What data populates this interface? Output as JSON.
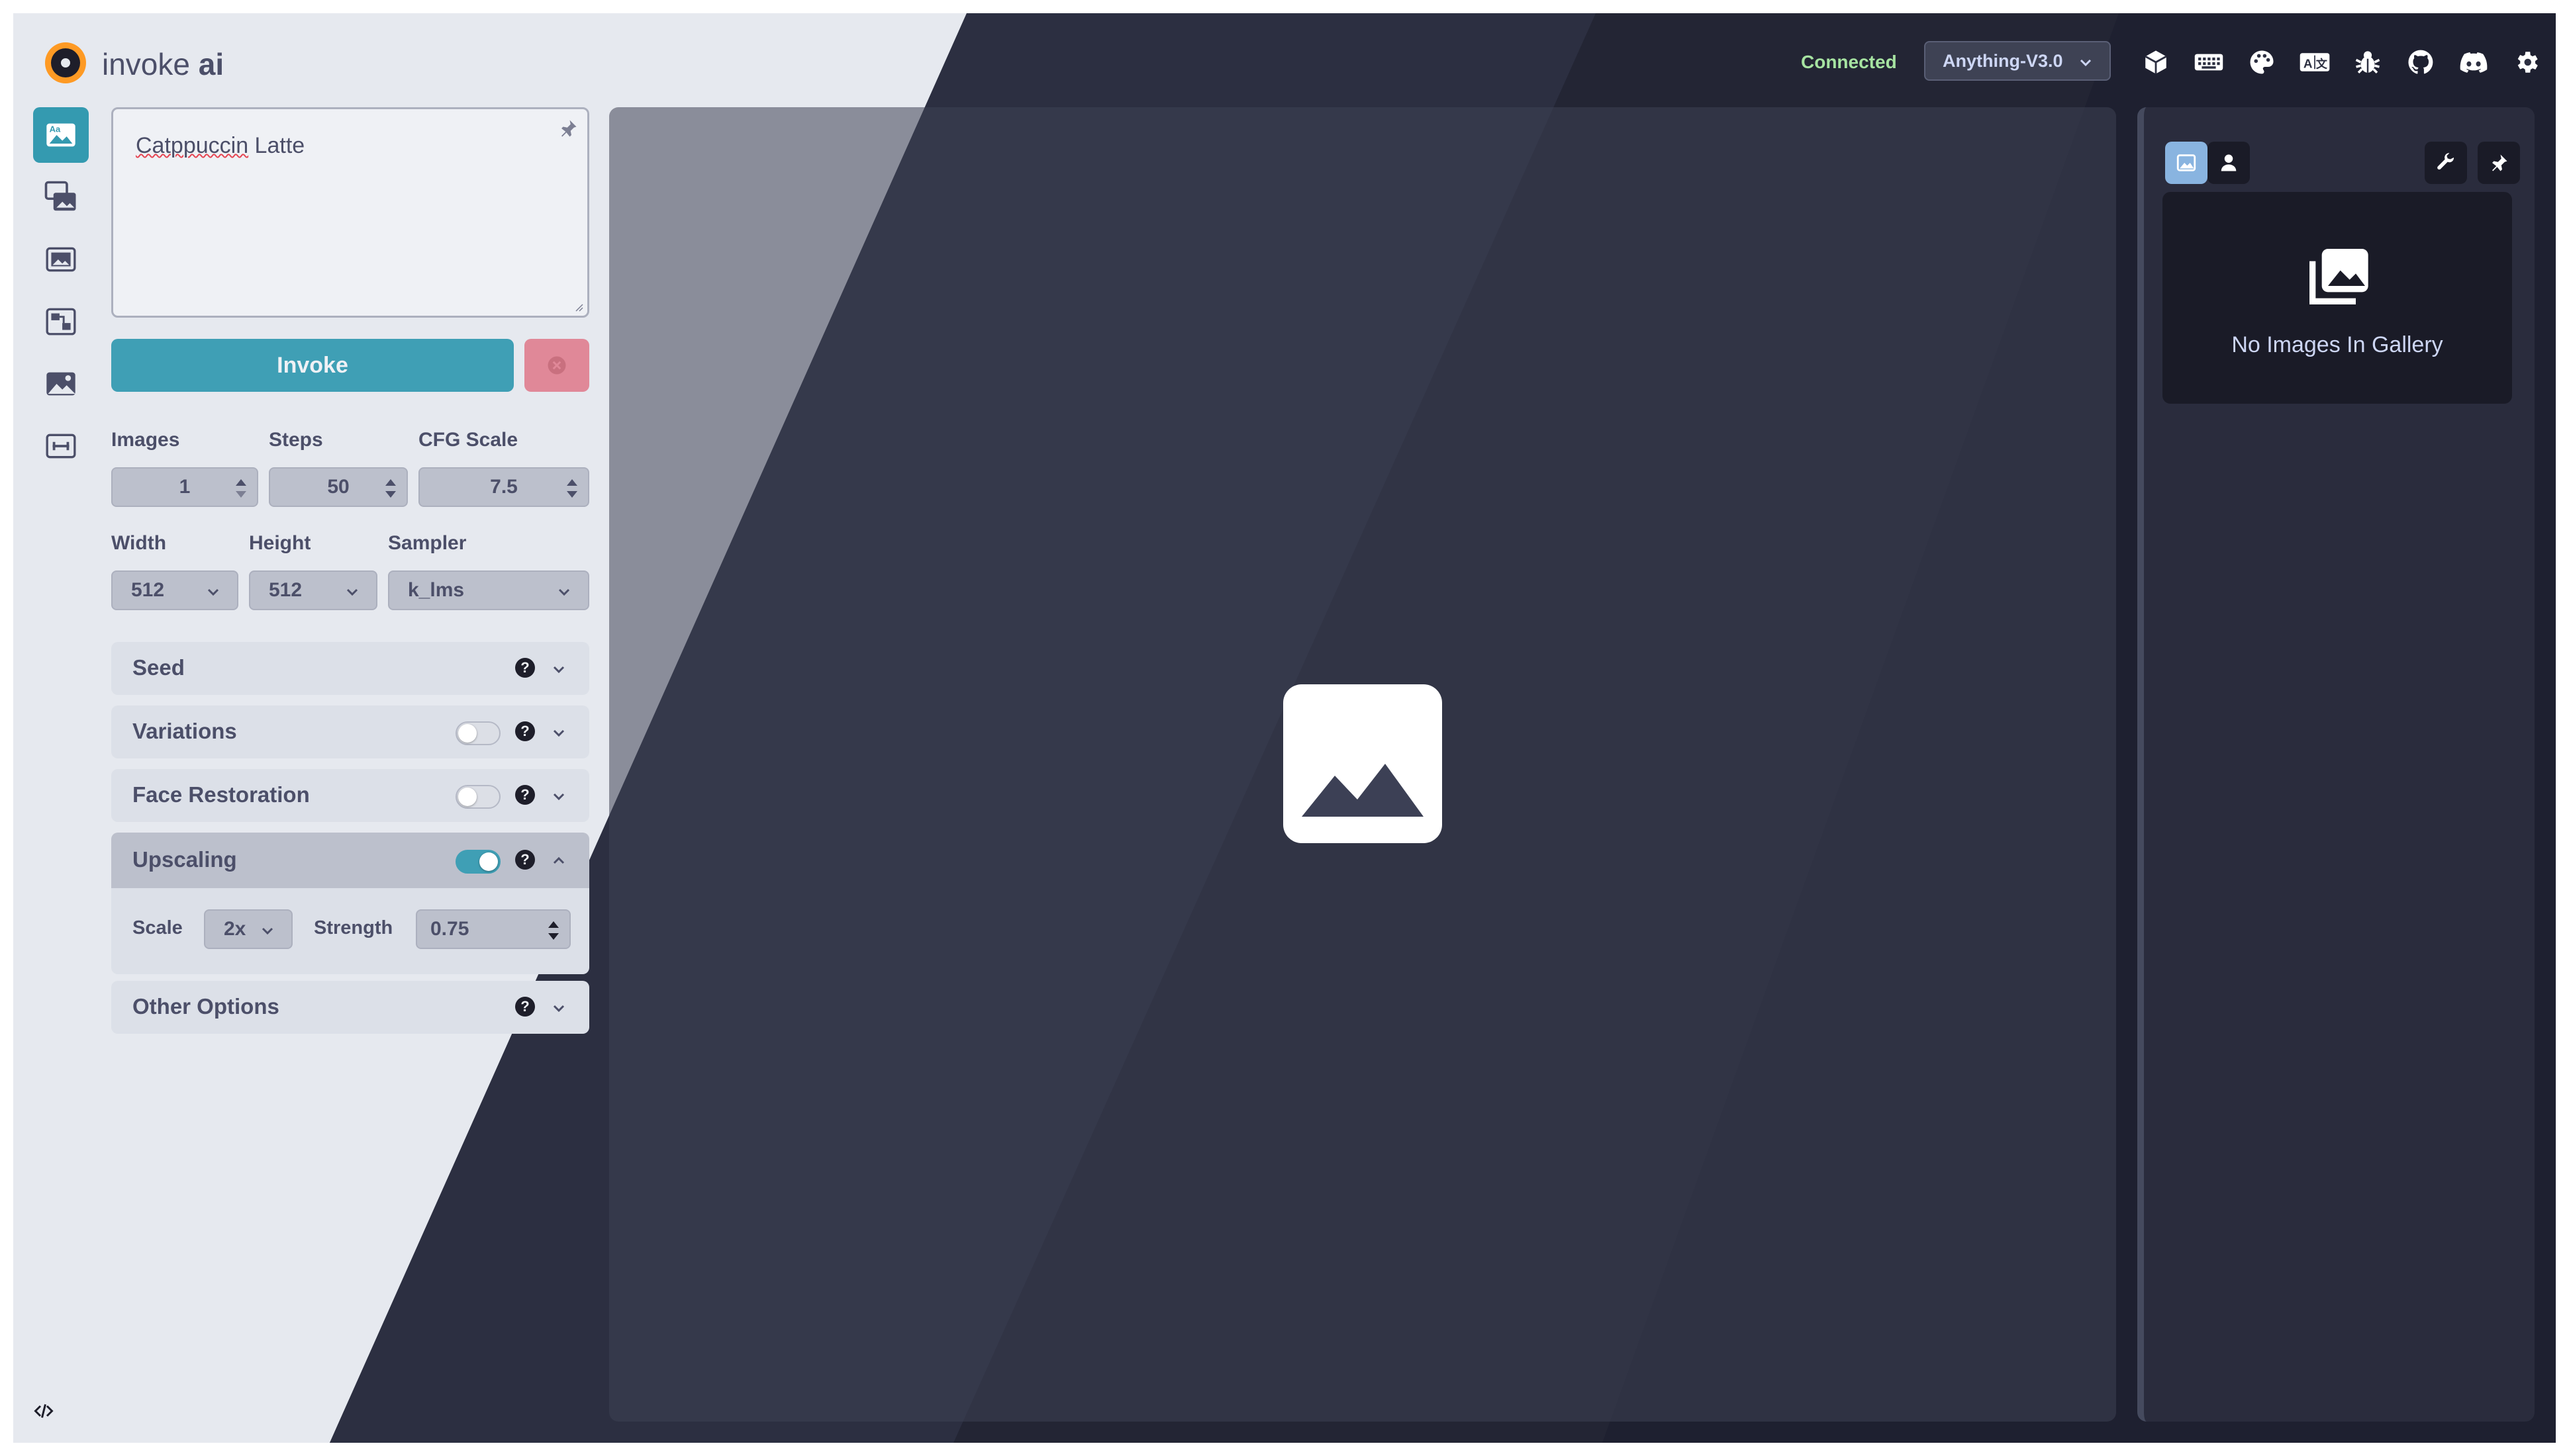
{
  "app": {
    "brand_name": "invoke",
    "brand_suffix": "ai"
  },
  "header": {
    "status": "Connected",
    "model": "Anything-V3.0",
    "status_color": "#a6e3a1",
    "icons": [
      "cube-icon",
      "keyboard-icon",
      "palette-icon",
      "language-icon",
      "bug-icon",
      "github-icon",
      "discord-icon",
      "gear-icon"
    ]
  },
  "rail": {
    "items": [
      "text-to-image-icon",
      "image-to-image-icon",
      "inpainting-icon",
      "nodes-icon",
      "outpainting-icon",
      "training-icon"
    ],
    "active_index": 0
  },
  "prompt": {
    "value_word": "Catppuccin",
    "value_rest": " Latte"
  },
  "actions": {
    "invoke_label": "Invoke"
  },
  "params": {
    "images_label": "Images",
    "images_value": "1",
    "steps_label": "Steps",
    "steps_value": "50",
    "cfg_label": "CFG Scale",
    "cfg_value": "7.5",
    "width_label": "Width",
    "width_value": "512",
    "height_label": "Height",
    "height_value": "512",
    "sampler_label": "Sampler",
    "sampler_value": "k_lms"
  },
  "accordions": {
    "seed": "Seed",
    "variations": "Variations",
    "face_restoration": "Face Restoration",
    "upscaling": "Upscaling",
    "other_options": "Other Options",
    "help_glyph": "?"
  },
  "upscaling": {
    "scale_label": "Scale",
    "scale_value": "2x",
    "strength_label": "Strength",
    "strength_value": "0.75",
    "enabled": true
  },
  "gallery": {
    "empty_text": "No Images In Gallery"
  },
  "colors": {
    "accent": "#3f9fb5",
    "light_bg": "#e6e9ef",
    "dark_bg": "#1e1e2e"
  }
}
